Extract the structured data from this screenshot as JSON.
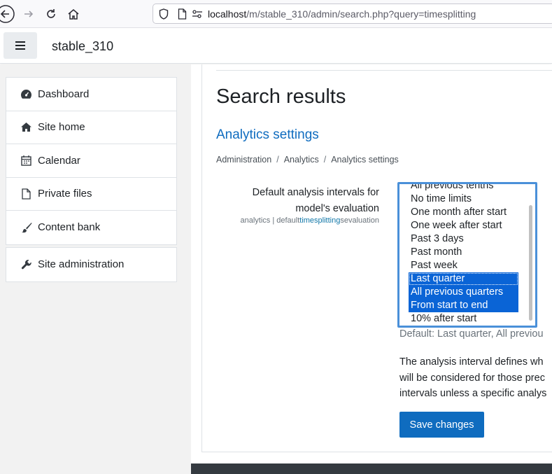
{
  "browser": {
    "url_host": "localhost",
    "url_path": "/m/stable_310/admin/search.php?query=timesplitting"
  },
  "header": {
    "site_name": "stable_310"
  },
  "drawer": {
    "items": [
      {
        "label": "Dashboard",
        "icon": "dashboard-icon"
      },
      {
        "label": "Site home",
        "icon": "home-icon"
      },
      {
        "label": "Calendar",
        "icon": "calendar-icon"
      },
      {
        "label": "Private files",
        "icon": "file-icon"
      },
      {
        "label": "Content bank",
        "icon": "paintbrush-icon"
      }
    ],
    "admin_item": {
      "label": "Site administration",
      "icon": "wrench-icon"
    }
  },
  "main": {
    "title": "Search results",
    "section_title": "Analytics settings",
    "breadcrumb": [
      "Administration",
      "Analytics",
      "Analytics settings"
    ],
    "breadcrumb_sep": "/",
    "setting": {
      "label_line1": "Default analysis intervals for",
      "label_line2": "model's evaluation",
      "name_prefix": "analytics | default",
      "name_highlight": "timesplitting",
      "name_suffix": "sevaluation",
      "options": [
        {
          "label": "All previous tenths",
          "selected": false
        },
        {
          "label": "No time limits",
          "selected": false
        },
        {
          "label": "One month after start",
          "selected": false
        },
        {
          "label": "One week after start",
          "selected": false
        },
        {
          "label": "Past 3 days",
          "selected": false
        },
        {
          "label": "Past month",
          "selected": false
        },
        {
          "label": "Past week",
          "selected": false
        },
        {
          "label": "Last quarter",
          "selected": true
        },
        {
          "label": "All previous quarters",
          "selected": true
        },
        {
          "label": "From start to end",
          "selected": true
        },
        {
          "label": "10% after start",
          "selected": false
        }
      ],
      "default_text": "Default: Last quarter, All previou",
      "description_lines": [
        "The analysis interval defines wh",
        "will be considered for those prec",
        "intervals unless a specific analys"
      ]
    },
    "save_label": "Save changes"
  },
  "colors": {
    "accent": "#0f6cbf",
    "selection": "#0a64d6",
    "focus_border": "#4a90d9"
  }
}
